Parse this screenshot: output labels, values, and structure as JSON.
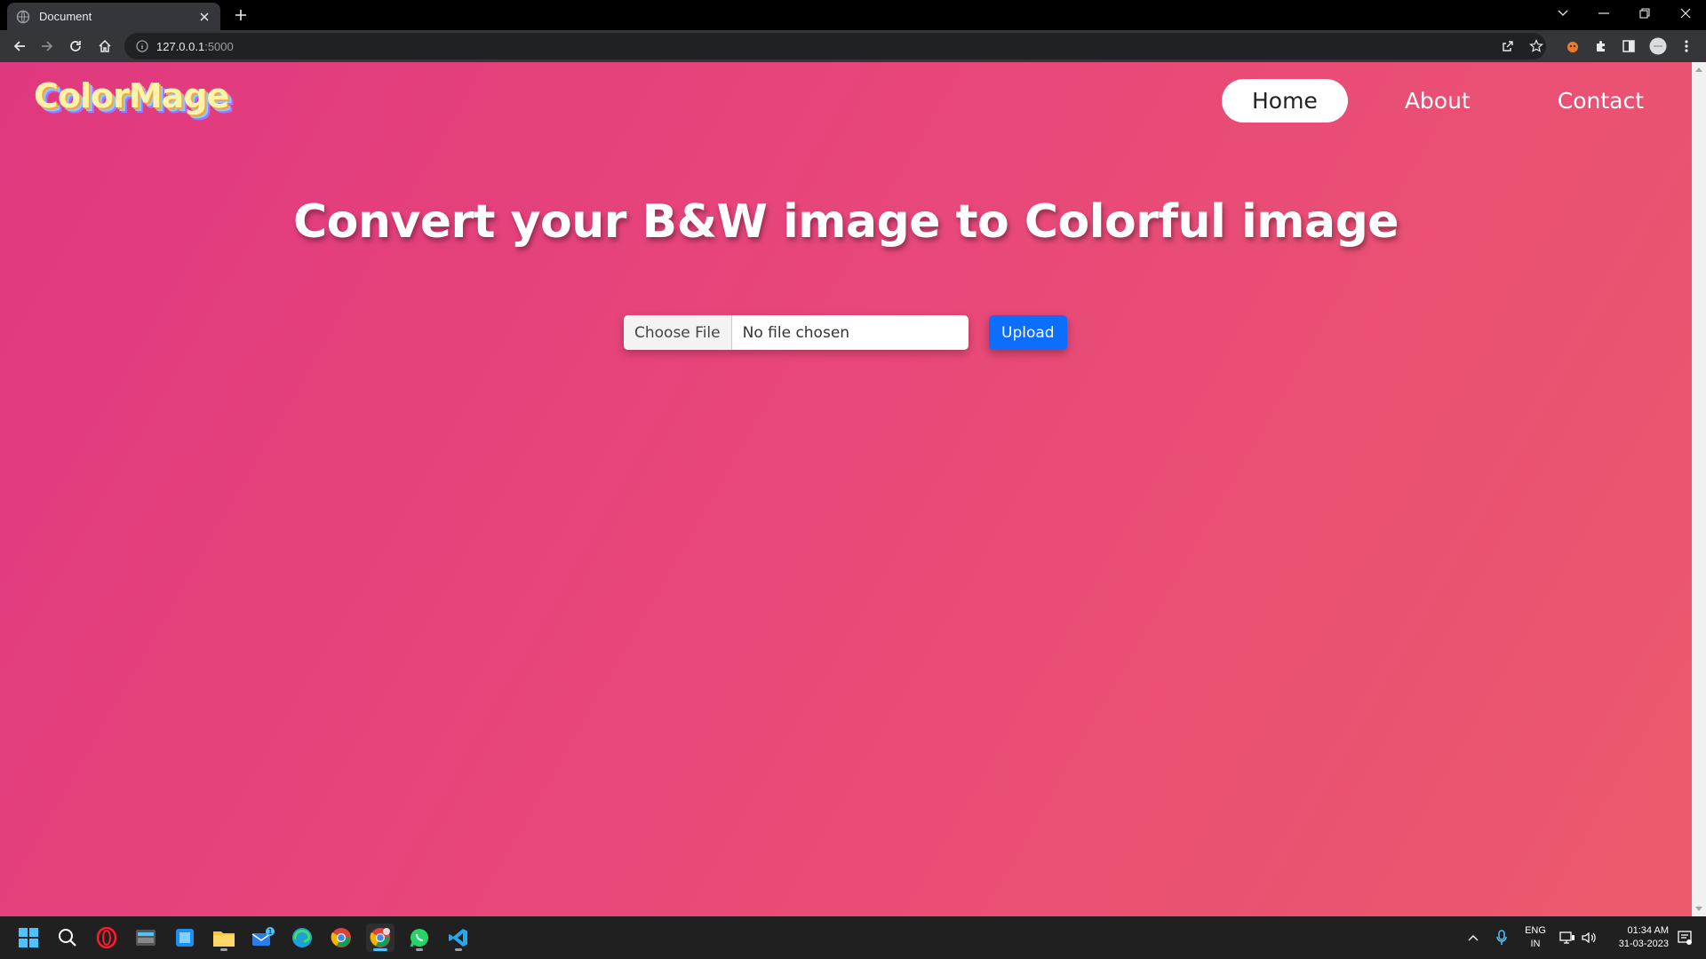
{
  "browser": {
    "tab_title": "Document",
    "url_host": "127.0.0.1",
    "url_port": ":5000"
  },
  "page": {
    "logo_text": "ColorMage",
    "nav": [
      {
        "label": "Home",
        "active": true
      },
      {
        "label": "About",
        "active": false
      },
      {
        "label": "Contact",
        "active": false
      }
    ],
    "headline": "Convert your B&W image to Colorful image",
    "file_input": {
      "button_label": "Choose File",
      "status_text": "No file chosen"
    },
    "upload_label": "Upload"
  },
  "taskbar": {
    "language": "ENG",
    "region": "IN",
    "time": "01:34 AM",
    "date": "31-03-2023",
    "mail_badge": "1"
  },
  "colors": {
    "gradient_start": "#e0387f",
    "gradient_end": "#ec5a6b",
    "upload_button": "#0d6efd"
  }
}
